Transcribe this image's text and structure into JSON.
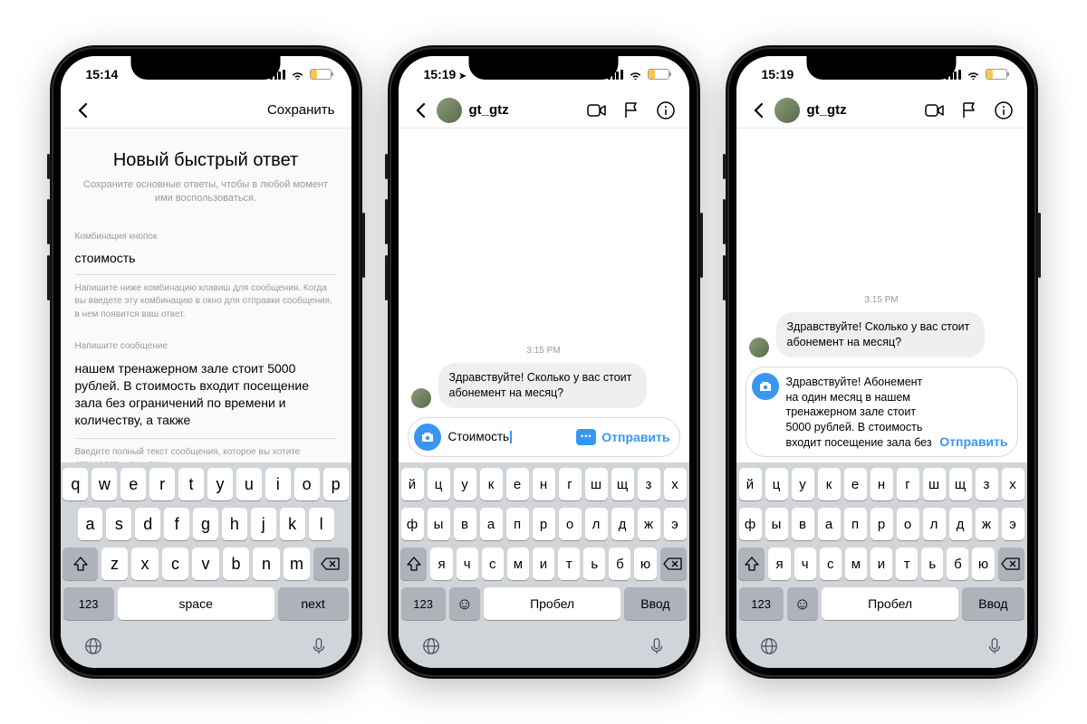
{
  "status": {
    "time1": "15:14",
    "time2": "15:19",
    "time3": "15:19"
  },
  "p1": {
    "save": "Сохранить",
    "title": "Новый быстрый ответ",
    "subtitle": "Сохраните основные ответы, чтобы в любой момент ими воспользоваться.",
    "shortcut_label": "Комбинация кнопок",
    "shortcut_value": "стоимость",
    "shortcut_hint": "Напишите ниже комбинацию клавиш для сообщения. Когда вы введете эту комбинацию в окно для отправки сообщения, в нем появится ваш ответ.",
    "message_label": "Напишите сообщение",
    "message_value": "нашем тренажерном зале стоит 5000 рублей. В стоимость входит посещение зала без ограничений по времени и количеству, а также",
    "message_hint": "Введите полный текст сообщения, которое вы хотите отправлять клиентам."
  },
  "chat": {
    "username": "gt_gtz",
    "timestamp": "3:15 PM",
    "incoming": "Здравствуйте! Сколько у вас стоит абонемент на месяц?",
    "composer2": "Стоимость",
    "composer3": "Здравствуйте! Абонемент на один месяц в нашем тренажерном зале стоит 5000 рублей. В стоимость входит посещение зала без",
    "send": "Отправить"
  },
  "kbd": {
    "en": {
      "r1": [
        "q",
        "w",
        "e",
        "r",
        "t",
        "y",
        "u",
        "i",
        "o",
        "p"
      ],
      "r2": [
        "a",
        "s",
        "d",
        "f",
        "g",
        "h",
        "j",
        "k",
        "l"
      ],
      "r3": [
        "z",
        "x",
        "c",
        "v",
        "b",
        "n",
        "m"
      ],
      "num": "123",
      "space": "space",
      "action": "next"
    },
    "ru": {
      "r1": [
        "й",
        "ц",
        "у",
        "к",
        "е",
        "н",
        "г",
        "ш",
        "щ",
        "з",
        "х"
      ],
      "r2": [
        "ф",
        "ы",
        "в",
        "а",
        "п",
        "р",
        "о",
        "л",
        "д",
        "ж",
        "э"
      ],
      "r3": [
        "я",
        "ч",
        "с",
        "м",
        "и",
        "т",
        "ь",
        "б",
        "ю"
      ],
      "num": "123",
      "space": "Пробел",
      "action": "Ввод"
    }
  }
}
